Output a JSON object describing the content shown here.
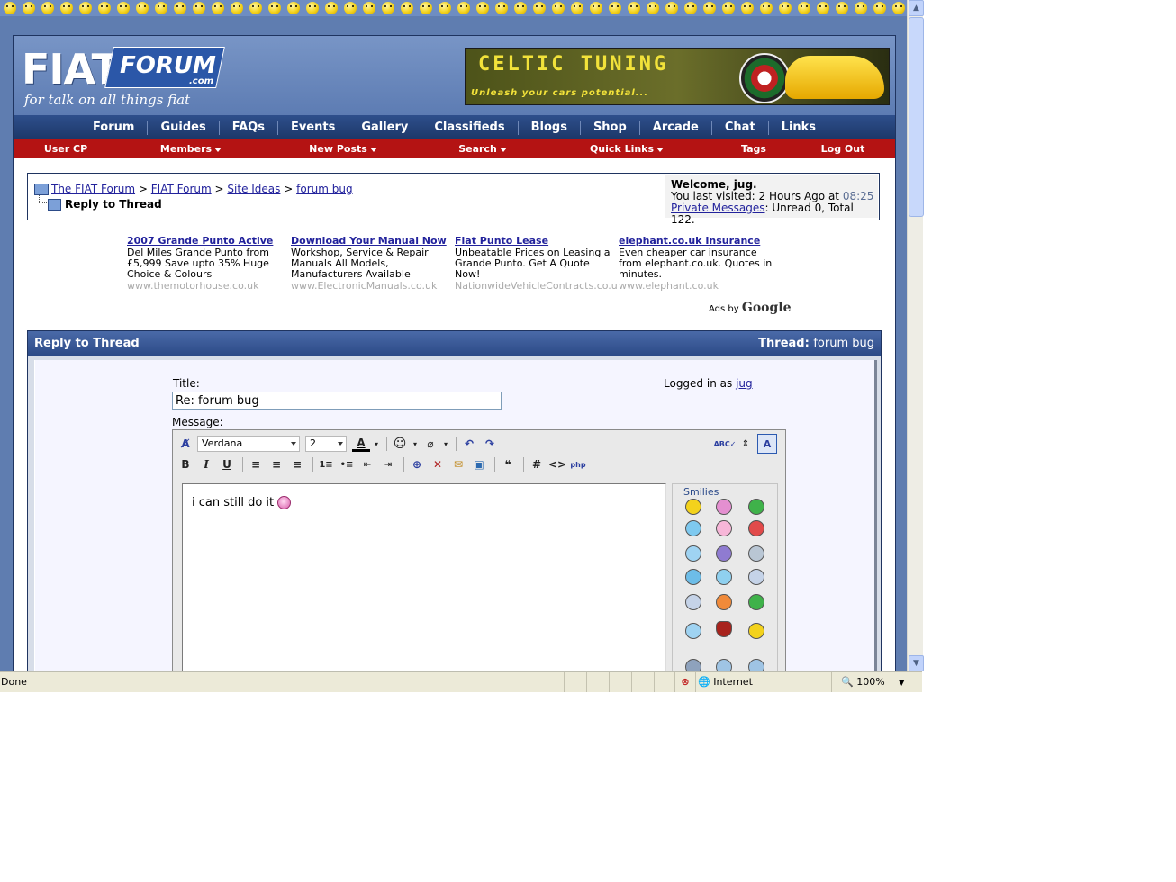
{
  "header": {
    "logo_main": "FIAT",
    "logo_forum": "FORUM",
    "logo_com": ".com",
    "logo_tagline": "for talk on all things fiat",
    "banner_title": "CELTIC TUNING",
    "banner_sub": "Unleash your cars potential..."
  },
  "navbar": [
    "Forum",
    "Guides",
    "FAQs",
    "Events",
    "Gallery",
    "Classifieds",
    "Blogs",
    "Shop",
    "Arcade",
    "Chat",
    "Links"
  ],
  "subnav": [
    {
      "label": "User CP",
      "dropdown": false
    },
    {
      "label": "Members",
      "dropdown": true
    },
    {
      "label": "New Posts",
      "dropdown": true
    },
    {
      "label": "Search",
      "dropdown": true
    },
    {
      "label": "Quick Links",
      "dropdown": true
    },
    {
      "label": "Tags",
      "dropdown": false
    },
    {
      "label": "Log Out",
      "dropdown": false
    }
  ],
  "breadcrumb": {
    "links": [
      "The FIAT Forum",
      "FIAT Forum",
      "Site Ideas",
      "forum bug"
    ],
    "separator": ">",
    "current": "Reply to Thread"
  },
  "welcome": {
    "greeting": "Welcome, jug.",
    "last_visited_prefix": "You last visited: 2 Hours Ago at",
    "last_visited_time": "08:25",
    "pm_link": "Private Messages",
    "pm_counts": ": Unread 0, Total 122."
  },
  "ads": [
    {
      "title": "2007 Grande Punto Active",
      "lines": [
        "Del Miles Grande Punto from",
        "£5,999 Save upto 35% Huge",
        "Choice & Colours"
      ],
      "url": "www.themotorhouse.co.uk"
    },
    {
      "title": "Download Your Manual Now",
      "lines": [
        "Workshop, Service & Repair",
        "Manuals All Models,",
        "Manufacturers Available"
      ],
      "url": "www.ElectronicManuals.co.uk"
    },
    {
      "title": "Fiat Punto Lease",
      "lines": [
        "Unbeatable Prices on Leasing a",
        "Grande Punto. Get A Quote",
        "Now!"
      ],
      "url": "NationwideVehicleContracts.co.u"
    },
    {
      "title": "elephant.co.uk Insurance",
      "lines": [
        "Even cheaper car insurance",
        "from elephant.co.uk. Quotes in",
        "minutes."
      ],
      "url": "www.elephant.co.uk"
    }
  ],
  "ads_by": {
    "prefix": "Ads by",
    "brand": "Google"
  },
  "reply": {
    "header_title": "Reply to Thread",
    "thread_label": "Thread:",
    "thread_name": "forum bug",
    "title_label": "Title:",
    "title_value": "Re: forum bug",
    "logged_in_prefix": "Logged in as",
    "logged_in_user": "jug",
    "message_label": "Message:",
    "message_text": "i can still do it",
    "font_name": "Verdana",
    "font_size": "2",
    "smilies_title": "Smilies"
  },
  "statusbar": {
    "status": "Done",
    "zone": "Internet",
    "zoom": "100%"
  },
  "colors": {
    "page_bg": "#5f7db0",
    "navbar": "#1c3768",
    "subnav": "#b41313",
    "link": "#22229c"
  }
}
